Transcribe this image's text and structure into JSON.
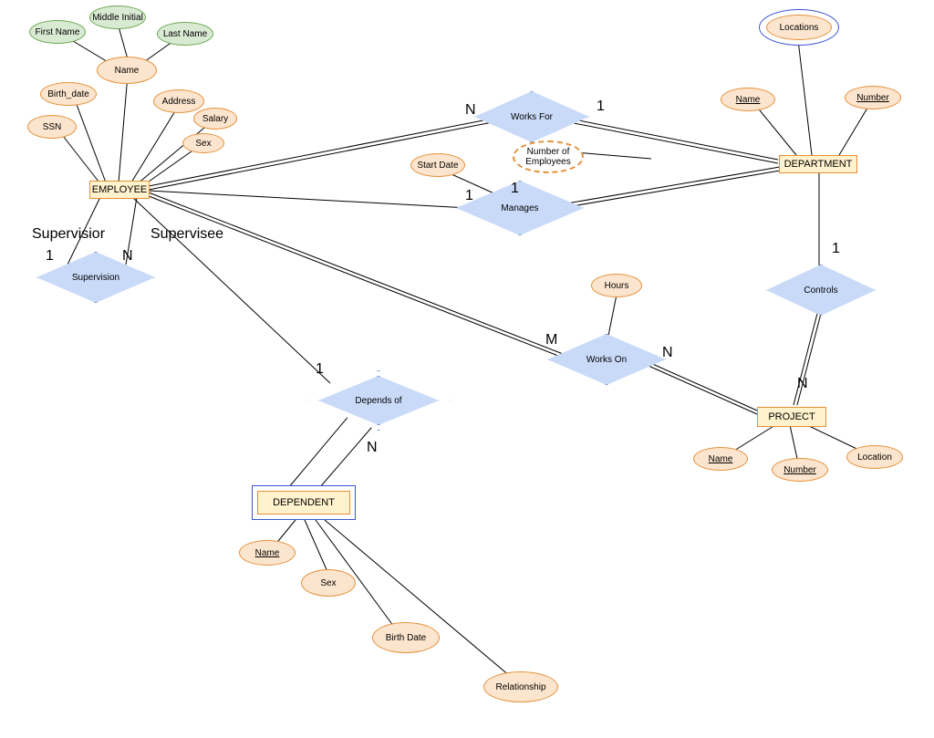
{
  "entities": {
    "employee": "EMPLOYEE",
    "department": "DEPARTMENT",
    "project": "PROJECT",
    "dependent": "DEPENDENT"
  },
  "relationships": {
    "works_for": "Works For",
    "manages": "Manages",
    "works_on": "Works On",
    "controls": "Controls",
    "supervision": "Supervision",
    "depends_of": "Depends of"
  },
  "attributes": {
    "employee": {
      "first_name": "First Name",
      "middle_initial": "Middle Initial",
      "last_name": "Last Name",
      "name": "Name",
      "birth_date": "Birth_date",
      "ssn": "SSN",
      "address": "Address",
      "salary": "Salary",
      "sex": "Sex"
    },
    "department": {
      "locations": "Locations",
      "name": "Name",
      "number": "Number"
    },
    "project": {
      "name": "Name",
      "number": "Number",
      "location": "Location"
    },
    "dependent": {
      "name": "Name",
      "sex": "Sex",
      "birth_date": "Birth Date",
      "relationship": "Relationship"
    },
    "works_for": {
      "number_of_employees": "Number of\nEmployees"
    },
    "manages": {
      "start_date": "Start Date"
    },
    "works_on": {
      "hours": "Hours"
    }
  },
  "participation": {
    "works_for_emp": "N",
    "works_for_dept": "1",
    "manages_emp": "1",
    "manages_dept": "1",
    "supervision_supervisor": "1",
    "supervision_supervisee": "N",
    "controls_dept": "1",
    "controls_proj": "N",
    "works_on_emp": "M",
    "works_on_proj": "N",
    "depends_emp": "1",
    "depends_dep": "N"
  },
  "roles": {
    "supervisor": "Supervisior",
    "supervisee": "Supervisee"
  }
}
